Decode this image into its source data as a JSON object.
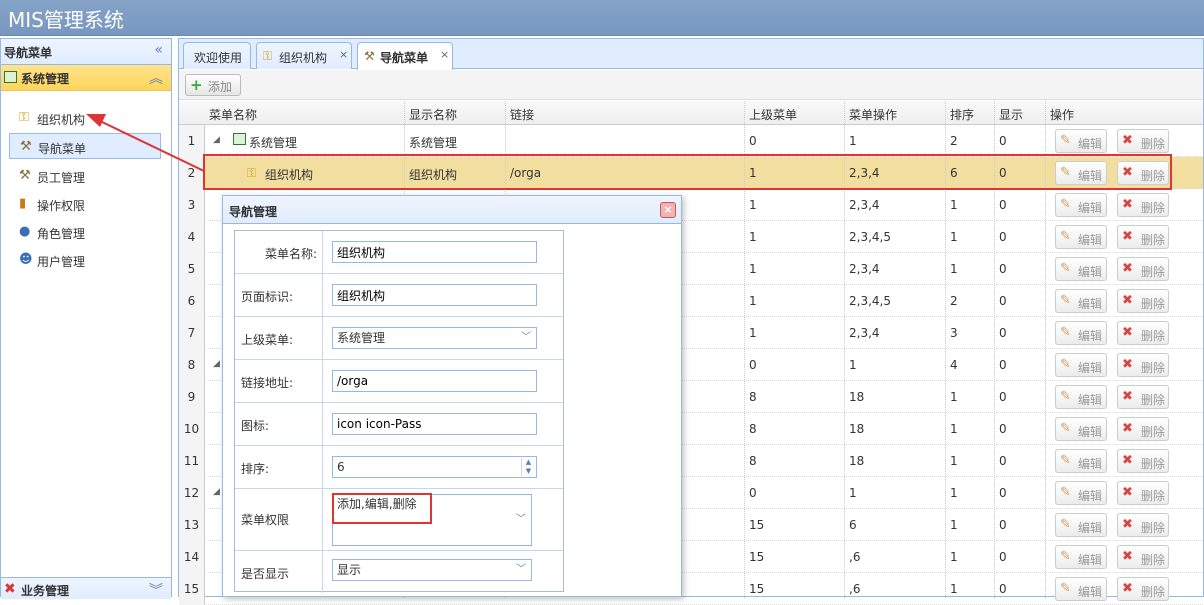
{
  "app": {
    "title": "MIS管理系统"
  },
  "sidebar": {
    "title": "导航菜单",
    "collapse_icon": "double-chevron-left-icon",
    "system_group": "系统管理",
    "items": [
      {
        "label": "组织机构",
        "icon": "key-icon"
      },
      {
        "label": "导航菜单",
        "icon": "wrench-icon"
      },
      {
        "label": "员工管理",
        "icon": "wrench-icon"
      },
      {
        "label": "操作权限",
        "icon": "book-icon"
      },
      {
        "label": "角色管理",
        "icon": "user-icon"
      },
      {
        "label": "用户管理",
        "icon": "users-icon"
      }
    ],
    "business_group": "业务管理"
  },
  "tabs": [
    {
      "label": "欢迎使用"
    },
    {
      "label": "组织机构",
      "close": "×"
    },
    {
      "label": "导航菜单",
      "close": "×"
    }
  ],
  "toolbar": {
    "add_label": "添加",
    "add_glyph": "+"
  },
  "grid": {
    "columns": [
      "菜单名称",
      "显示名称",
      "链接",
      "上级菜单",
      "菜单操作",
      "排序",
      "显示",
      "操作"
    ],
    "edit_label": "编辑",
    "delete_label": "删除",
    "edit_glyph": "✎",
    "delete_glyph": "✖",
    "rows": [
      {
        "n": "1",
        "name": "系统管理",
        "display": "系统管理",
        "link": "",
        "parent": "0",
        "ops": "1",
        "sort": "2",
        "show": "0"
      },
      {
        "n": "2",
        "name": "组织机构",
        "display": "组织机构",
        "link": "/orga",
        "parent": "1",
        "ops": "2,3,4",
        "sort": "6",
        "show": "0"
      },
      {
        "n": "3",
        "name": "",
        "display": "",
        "link": "",
        "parent": "1",
        "ops": "2,3,4",
        "sort": "1",
        "show": "0"
      },
      {
        "n": "4",
        "name": "",
        "display": "",
        "link": "",
        "parent": "1",
        "ops": "2,3,4,5",
        "sort": "1",
        "show": "0"
      },
      {
        "n": "5",
        "name": "",
        "display": "",
        "link": "",
        "parent": "1",
        "ops": "2,3,4",
        "sort": "1",
        "show": "0"
      },
      {
        "n": "6",
        "name": "",
        "display": "",
        "link": "",
        "parent": "1",
        "ops": "2,3,4,5",
        "sort": "2",
        "show": "0"
      },
      {
        "n": "7",
        "name": "",
        "display": "",
        "link": "",
        "parent": "1",
        "ops": "2,3,4",
        "sort": "3",
        "show": "0"
      },
      {
        "n": "8",
        "name": "",
        "display": "",
        "link": "",
        "parent": "0",
        "ops": "1",
        "sort": "4",
        "show": "0"
      },
      {
        "n": "9",
        "name": "",
        "display": "",
        "link": "",
        "parent": "8",
        "ops": "18",
        "sort": "1",
        "show": "0"
      },
      {
        "n": "10",
        "name": "",
        "display": "",
        "link": "",
        "parent": "8",
        "ops": "18",
        "sort": "1",
        "show": "0"
      },
      {
        "n": "11",
        "name": "",
        "display": "",
        "link": "",
        "parent": "8",
        "ops": "18",
        "sort": "1",
        "show": "0"
      },
      {
        "n": "12",
        "name": "",
        "display": "",
        "link": "",
        "parent": "0",
        "ops": "1",
        "sort": "1",
        "show": "0"
      },
      {
        "n": "13",
        "name": "",
        "display": "",
        "link": "",
        "parent": "15",
        "ops": "6",
        "sort": "1",
        "show": "0"
      },
      {
        "n": "14",
        "name": "",
        "display": "",
        "link": "",
        "parent": "15",
        "ops": ",6",
        "sort": "1",
        "show": "0"
      },
      {
        "n": "15",
        "name": "",
        "display": "",
        "link": "",
        "parent": "15",
        "ops": ",6",
        "sort": "1",
        "show": "0"
      }
    ]
  },
  "dialog": {
    "title": "导航管理",
    "close_glyph": "×",
    "fields": {
      "name_label": "菜单名称:",
      "name_value": "组织机构",
      "page_label": "页面标识:",
      "page_value": "组织机构",
      "parent_label": "上级菜单:",
      "parent_value": "系统管理",
      "link_label": "链接地址:",
      "link_value": "/orga",
      "icon_label": "图标:",
      "icon_value": "icon icon-Pass",
      "sort_label": "排序:",
      "sort_value": "6",
      "perm_label": "菜单权限",
      "perm_value": "添加,编辑,删除",
      "show_label": "是否显示",
      "show_value": "显示"
    }
  },
  "colors": {
    "highlight": "#e03333",
    "selected_row": "#f2dfa0",
    "header": "#7897c0"
  }
}
